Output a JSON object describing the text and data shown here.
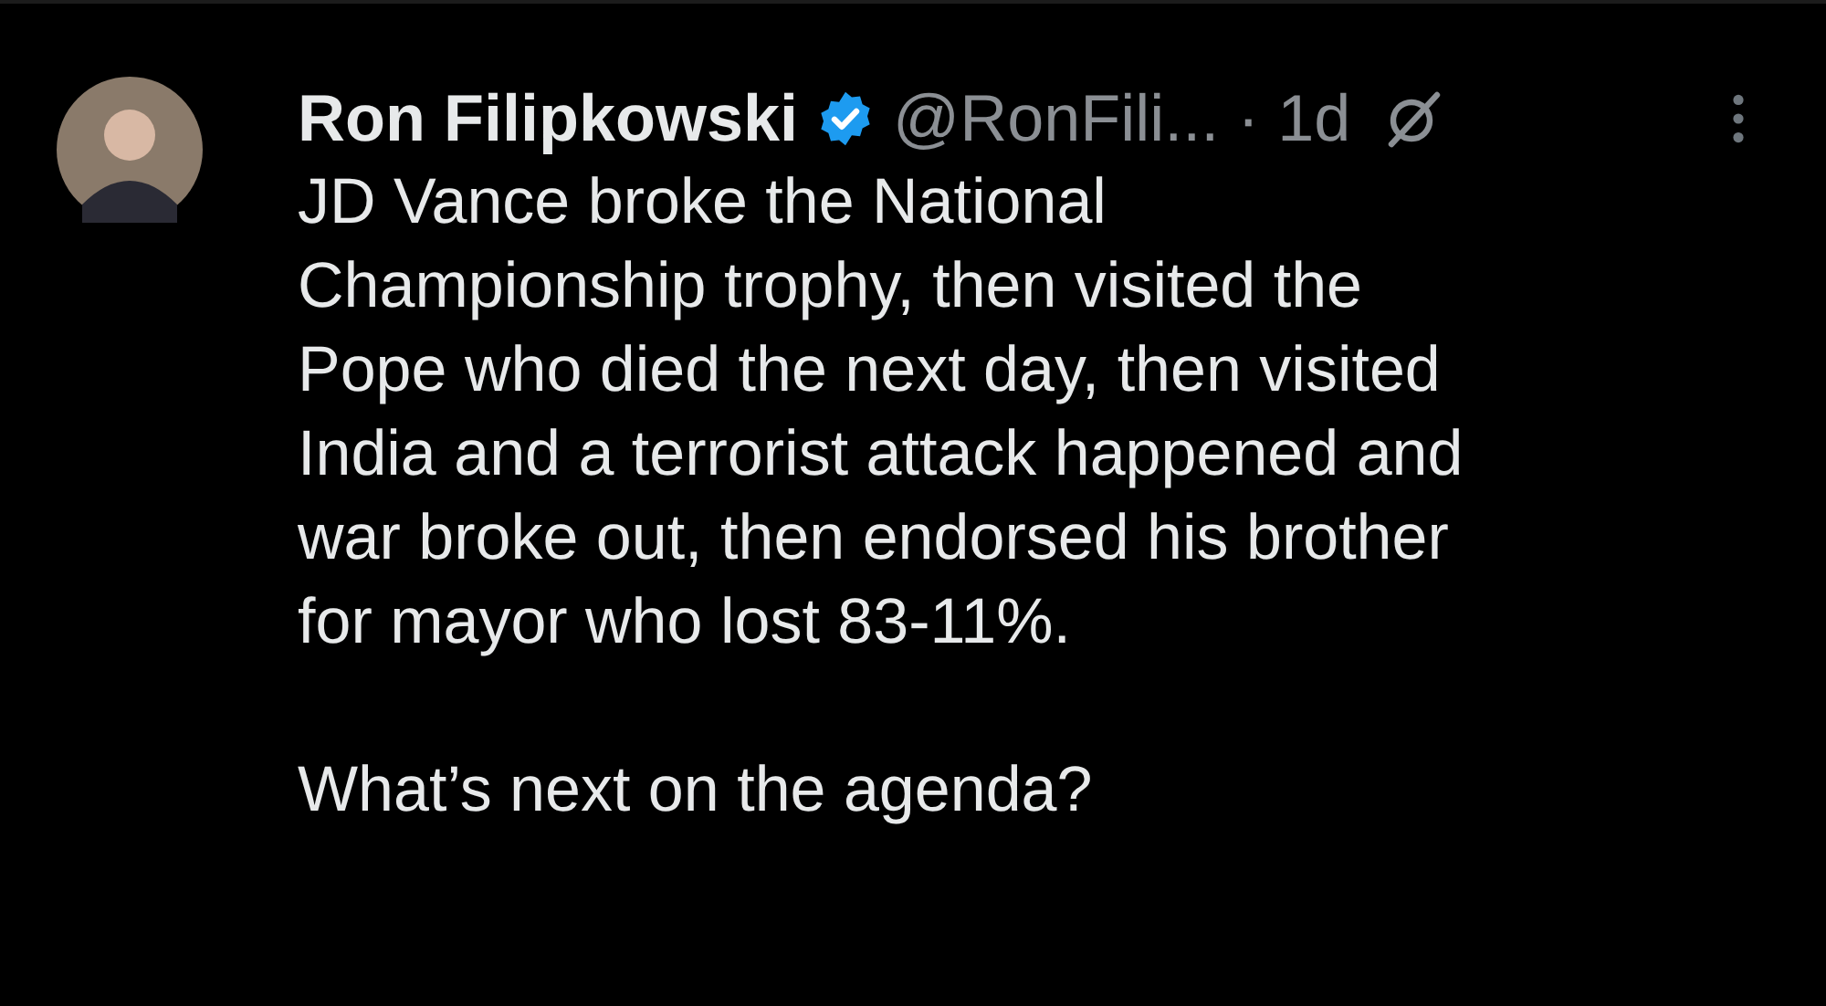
{
  "author": {
    "name": "Ron Filipkowski",
    "verified": true,
    "handle": "@RonFili...",
    "time": "· 1d"
  },
  "paragraphs": [
    {
      "lines": [
        "JD Vance broke the National",
        "Championship trophy, then visited the",
        "Pope who died the next day, then visited",
        "India and a terrorist attack happened and",
        "war broke out, then endorsed his brother",
        "for mayor who lost 83-11%."
      ]
    },
    {
      "lines": [
        "What’s next on the agenda?"
      ]
    }
  ]
}
